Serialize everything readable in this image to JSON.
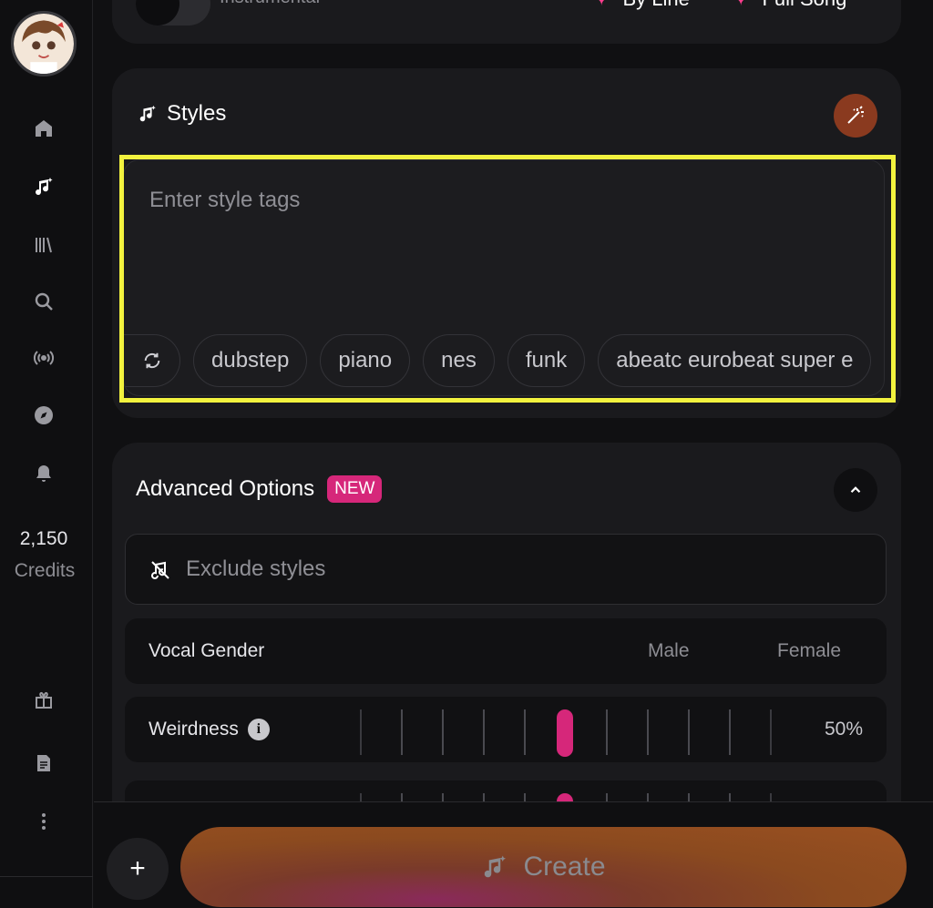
{
  "sidebar": {
    "credits_value": "2,150",
    "credits_label": "Credits",
    "nav": [
      "home-icon",
      "create-music-icon",
      "library-icon",
      "search-icon",
      "radio-icon",
      "explore-icon",
      "bell-icon"
    ],
    "bottom_nav": [
      "gift-icon",
      "document-icon",
      "more-icon"
    ]
  },
  "top_card": {
    "instrumental_label": "Instrumental",
    "by_line_label": "By Line",
    "full_song_label": "Full Song"
  },
  "styles": {
    "title": "Styles",
    "placeholder": "Enter style tags",
    "tags": [
      "dubstep",
      "piano",
      "nes",
      "funk",
      "abeatc eurobeat super e"
    ]
  },
  "advanced": {
    "title": "Advanced Options",
    "badge": "NEW",
    "exclude_placeholder": "Exclude styles",
    "vocal_gender_label": "Vocal Gender",
    "male_label": "Male",
    "female_label": "Female",
    "weirdness_label": "Weirdness",
    "weirdness_value": "50%"
  },
  "footer": {
    "create_label": "Create",
    "plus_label": "+"
  },
  "colors": {
    "accent": "#d6277a",
    "spark": "#ff3d8e",
    "highlight": "#f2f23e"
  }
}
